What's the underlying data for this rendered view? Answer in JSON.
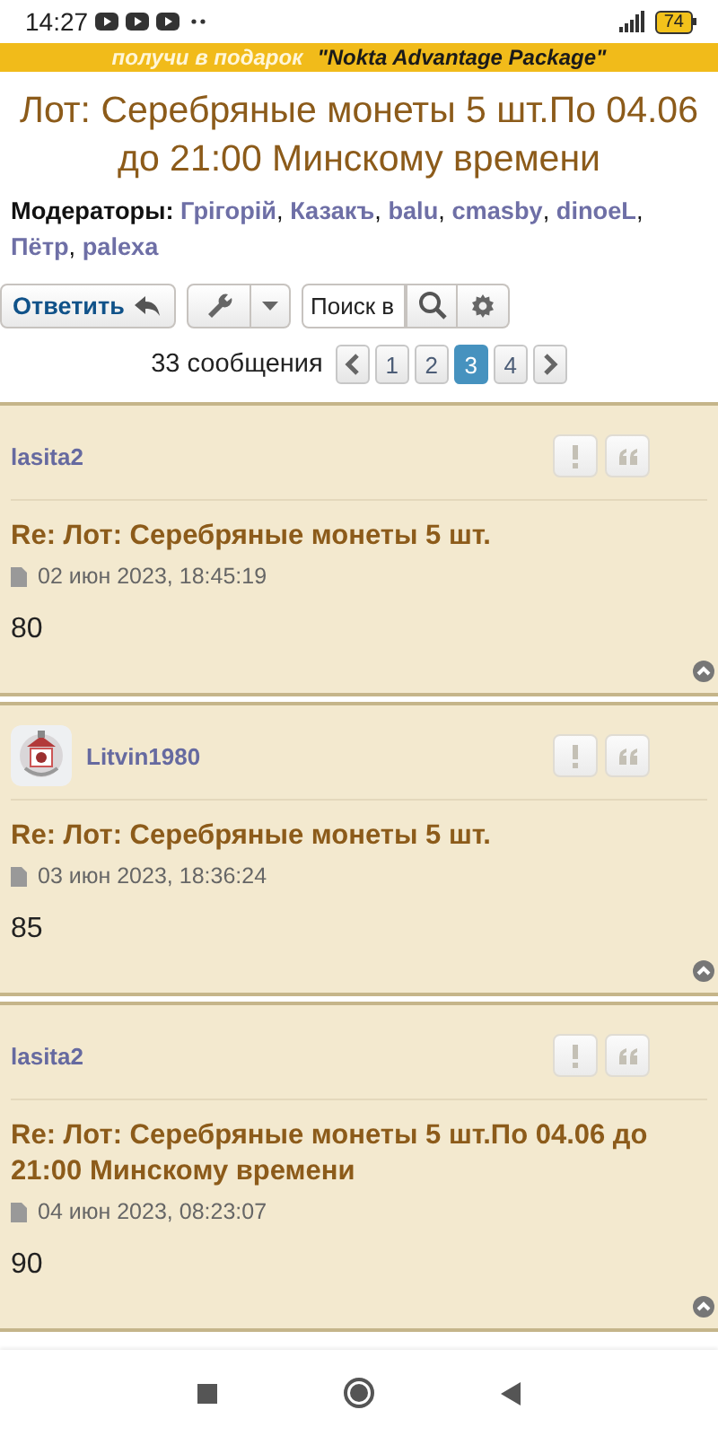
{
  "status_bar": {
    "time": "14:27",
    "battery": "74"
  },
  "banner": {
    "lead": "получи в подарок",
    "highlight": "\"Nokta Advantage Package\""
  },
  "topic": {
    "title": "Лот: Серебряные монеты 5 шт.По 04.06 до 21:00 Минскому времени"
  },
  "moderators": {
    "label": "Модераторы:",
    "separator": ",",
    "names": [
      "Грігорій",
      "Казакъ",
      "balu",
      "cmasby",
      "dinoeL",
      "Пётр",
      "palexa"
    ]
  },
  "toolbar": {
    "reply": "Ответить",
    "search": {
      "placeholder": "Поиск в"
    }
  },
  "pagination": {
    "count": "33 сообщения",
    "pages": [
      {
        "label": "1",
        "selected": false
      },
      {
        "label": "2",
        "selected": false
      },
      {
        "label": "3",
        "selected": true
      },
      {
        "label": "4",
        "selected": false
      }
    ]
  },
  "posts": [
    {
      "author": "lasita2",
      "avatar": false,
      "subject": "Re: Лот: Серебряные монеты 5 шт.",
      "date": "02 июн 2023, 18:45:19",
      "body": "80"
    },
    {
      "author": "Litvin1980",
      "avatar": true,
      "subject": "Re: Лот: Серебряные монеты 5 шт.",
      "date": "03 июн 2023, 18:36:24",
      "body": "85"
    },
    {
      "author": "lasita2",
      "avatar": false,
      "subject": "Re: Лот: Серебряные монеты 5 шт.По 04.06 до 21:00 Минскому времени",
      "date": "04 июн 2023, 08:23:07",
      "body": "90"
    }
  ]
}
